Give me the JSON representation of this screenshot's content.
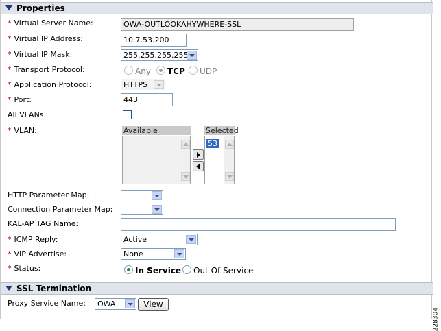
{
  "properties": {
    "header": "Properties",
    "virtual_server_name": {
      "label": "Virtual Server Name:",
      "value": "OWA-OUTLOOKAHYWHERE-SSL"
    },
    "virtual_ip_address": {
      "label": "Virtual IP Address:",
      "value": "10.7.53.200"
    },
    "virtual_ip_mask": {
      "label": "Virtual IP Mask:",
      "value": "255.255.255.255"
    },
    "transport_protocol": {
      "label": "Transport Protocol:",
      "options": [
        "Any",
        "TCP",
        "UDP"
      ],
      "selected": "TCP"
    },
    "application_protocol": {
      "label": "Application Protocol:",
      "value": "HTTPS"
    },
    "port": {
      "label": "Port:",
      "value": "443"
    },
    "all_vlans": {
      "label": "All VLANs:",
      "checked": false
    },
    "vlan": {
      "label": "VLAN:",
      "available_header": "Available",
      "selected_header": "Selected",
      "available": [],
      "selected": [
        "53"
      ]
    },
    "http_parameter_map": {
      "label": "HTTP Parameter Map:",
      "value": ""
    },
    "connection_parameter_map": {
      "label": "Connection Parameter Map:",
      "value": ""
    },
    "kal_ap_tag_name": {
      "label": "KAL-AP TAG Name:",
      "value": ""
    },
    "icmp_reply": {
      "label": "ICMP Reply:",
      "value": "Active"
    },
    "vip_advertise": {
      "label": "VIP Advertise:",
      "value": "None"
    },
    "status": {
      "label": "Status:",
      "options": [
        "In Service",
        "Out Of Service"
      ],
      "selected": "In Service"
    }
  },
  "ssl_termination": {
    "header": "SSL Termination",
    "proxy_service_name": {
      "label": "Proxy Service Name:",
      "value": "OWA"
    },
    "view_button": "View"
  },
  "figure_id": "228304",
  "required_marker": "*",
  "colors": {
    "required": "#c00000",
    "header_bg": "#dfe3ea",
    "selected_item": "#316ac5",
    "radio_dot": "#2a8a2a"
  }
}
